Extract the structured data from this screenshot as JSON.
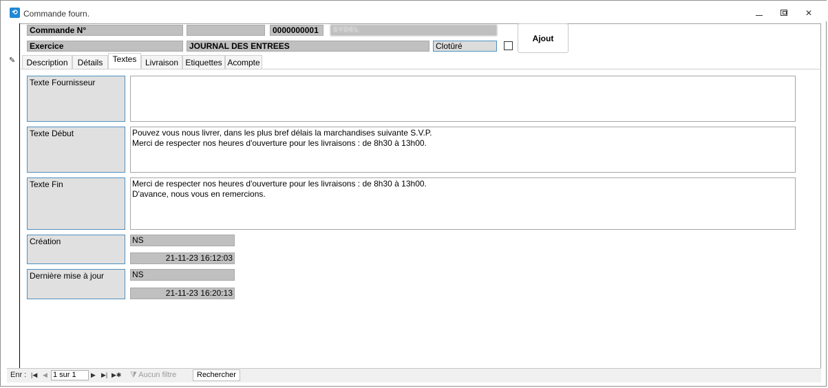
{
  "window": {
    "title": "Commande fourn.",
    "icon": "app-icon"
  },
  "header": {
    "commande_label": "Commande N°",
    "commande_field_2": "",
    "commande_number": "0000000001",
    "supplier_name": "SYDEL",
    "exercice_label": "Exercice",
    "journal": "JOURNAL DES ENTREES",
    "cloture_label": "Clotûré",
    "cloture_checked": false,
    "ajout_label": "Ajout"
  },
  "tabs": [
    {
      "label": "Description"
    },
    {
      "label": "Détails"
    },
    {
      "label": "Textes"
    },
    {
      "label": "Livraison"
    },
    {
      "label": "Etiquettes"
    },
    {
      "label": "Acompte"
    }
  ],
  "textes": {
    "fournisseur_label": "Texte Fournisseur",
    "fournisseur_value": "",
    "debut_label": "Texte Début",
    "debut_value": "Pouvez vous nous livrer, dans les plus bref délais la marchandises suivante S.V.P.\nMerci de respecter nos heures d'ouverture pour les livraisons : de 8h30 à 13h00.",
    "fin_label": "Texte Fin",
    "fin_value": "Merci de respecter nos heures d'ouverture pour les livraisons : de 8h30 à 13h00.\nD'avance, nous vous en remercions."
  },
  "audit": {
    "creation_label": "Création",
    "creation_user": "NS",
    "creation_date": "21-11-23 16:12:03",
    "update_label": "Dernière mise à jour",
    "update_user": "NS",
    "update_date": "21-11-23 16:20:13"
  },
  "statusbar": {
    "enr_label": "Enr :",
    "record_position": "1 sur 1",
    "filter_label": "Aucun filtre",
    "search_label": "Rechercher"
  }
}
